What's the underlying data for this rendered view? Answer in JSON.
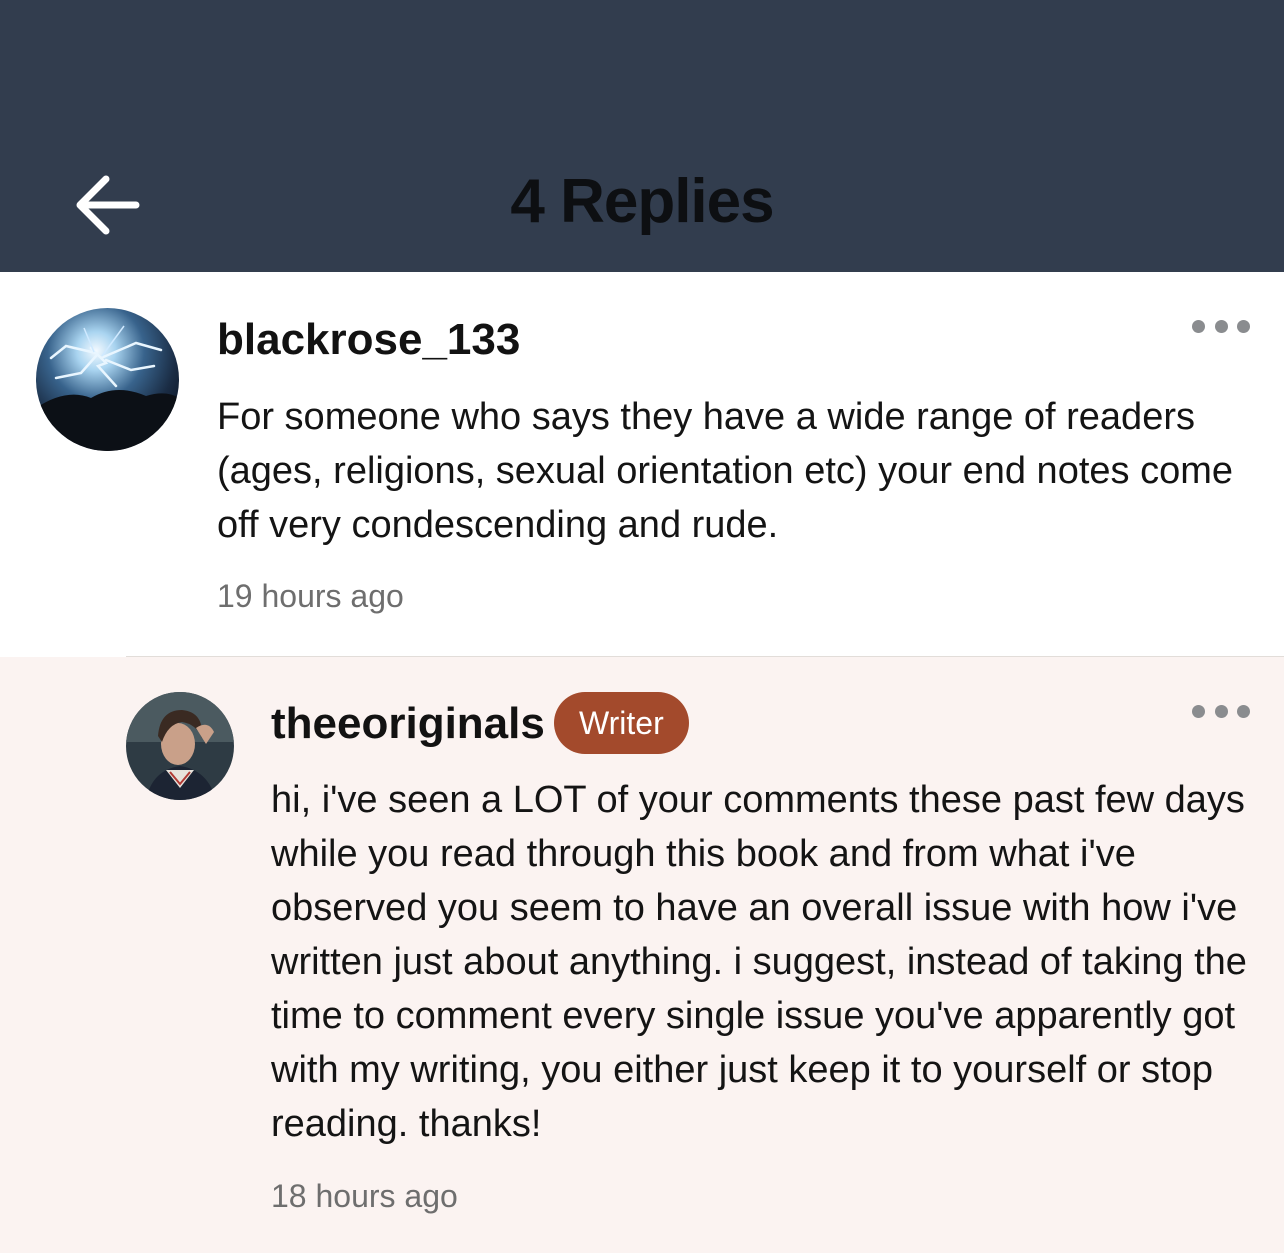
{
  "header": {
    "title": "4 Replies",
    "back_icon": "arrow-left-icon",
    "background_color": "#323d4e"
  },
  "comments": [
    {
      "username": "blackrose_133",
      "avatar": "lightning-storm-avatar",
      "text": "For someone who says they have a wide range of readers (ages, religions, sexual orientation etc) your end notes come off very condescending and rude.",
      "timestamp": "19 hours ago",
      "more_icon": "more-horizontal-icon"
    },
    {
      "username": "theeoriginals",
      "badge": "Writer",
      "badge_color": "#a34a2c",
      "avatar": "person-portrait-avatar",
      "text": "hi, i've seen a LOT of your comments these past few days while you read through this book and from what i've observed you seem to have an overall issue with how i've written just about anything. i suggest, instead of taking the time to comment every single issue you've apparently got with my writing, you either just keep it to yourself or stop reading. thanks!",
      "timestamp": "18 hours ago",
      "more_icon": "more-horizontal-icon",
      "background_color": "#fbf3f1"
    }
  ]
}
